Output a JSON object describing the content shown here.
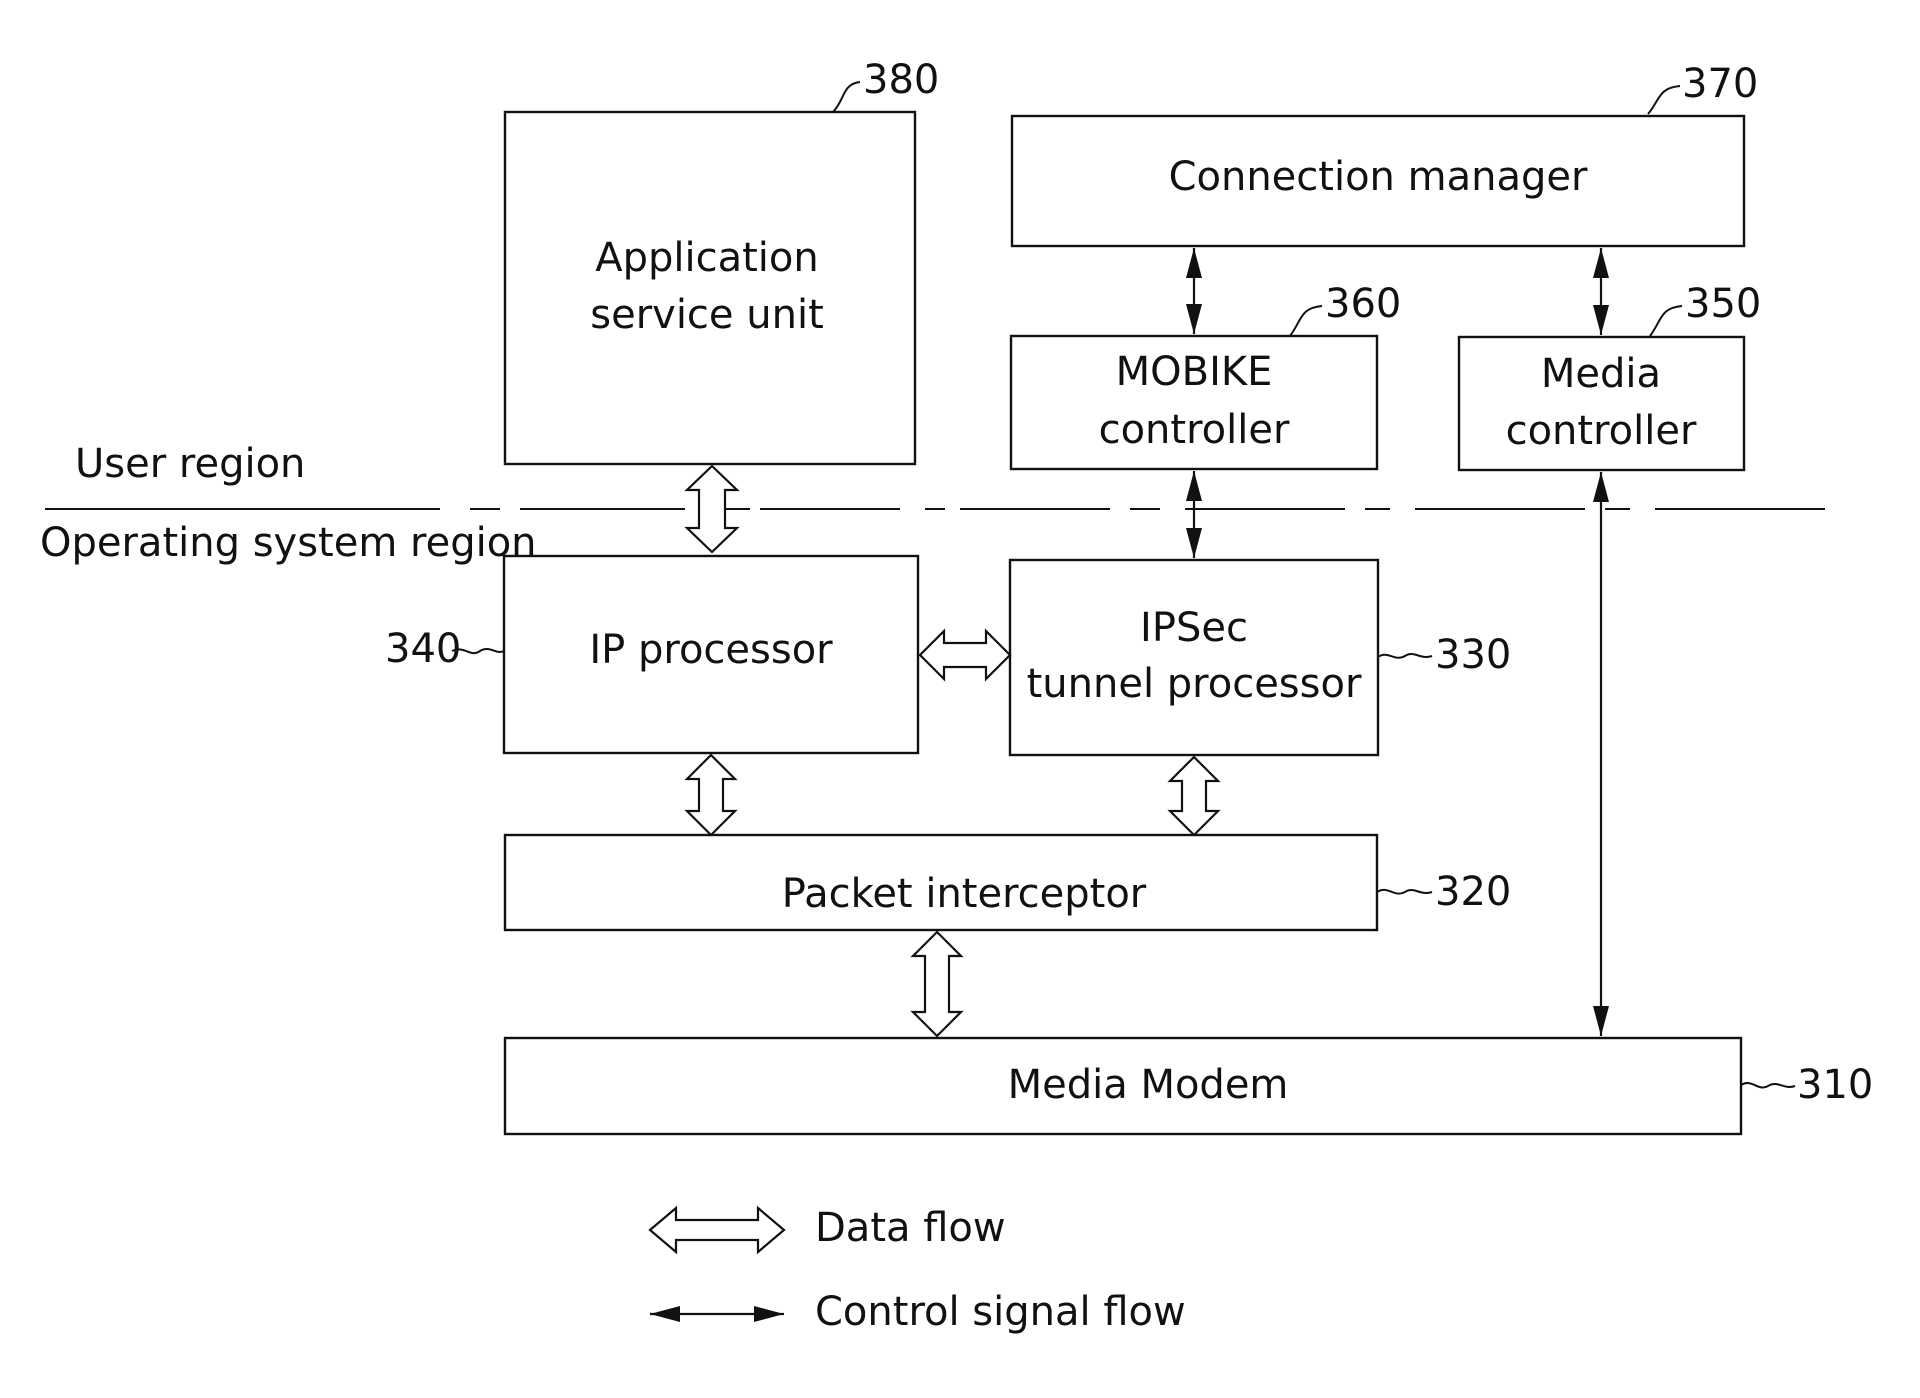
{
  "diagram": {
    "blocks": {
      "app_service": {
        "lines": [
          "Application",
          "service unit"
        ],
        "ref": "380"
      },
      "connection_manager": {
        "lines": [
          "Connection manager"
        ],
        "ref": "370"
      },
      "mobike_controller": {
        "lines": [
          "MOBIKE",
          "controller"
        ],
        "ref": "360"
      },
      "media_controller": {
        "lines": [
          "Media",
          "controller"
        ],
        "ref": "350"
      },
      "ip_processor": {
        "lines": [
          "IP processor"
        ],
        "ref": "340"
      },
      "ipsec_tunnel": {
        "lines": [
          "IPSec",
          "tunnel processor"
        ],
        "ref": "330"
      },
      "packet_interceptor": {
        "lines": [
          "Packet interceptor"
        ],
        "ref": "320"
      },
      "media_modem": {
        "lines": [
          "Media Modem"
        ],
        "ref": "310"
      }
    },
    "regions": {
      "user": "User region",
      "os": "Operating system region"
    },
    "connections": [
      {
        "from": "app_service",
        "to": "ip_processor",
        "type": "data"
      },
      {
        "from": "ip_processor",
        "to": "ipsec_tunnel",
        "type": "data"
      },
      {
        "from": "ip_processor",
        "to": "packet_interceptor",
        "type": "data"
      },
      {
        "from": "ipsec_tunnel",
        "to": "packet_interceptor",
        "type": "data"
      },
      {
        "from": "packet_interceptor",
        "to": "media_modem",
        "type": "data"
      },
      {
        "from": "connection_manager",
        "to": "mobike_controller",
        "type": "control"
      },
      {
        "from": "connection_manager",
        "to": "media_controller",
        "type": "control"
      },
      {
        "from": "mobike_controller",
        "to": "ipsec_tunnel",
        "type": "control"
      },
      {
        "from": "media_controller",
        "to": "media_modem",
        "type": "control"
      }
    ],
    "legend": {
      "data_flow": "Data flow",
      "control_flow": "Control signal flow"
    }
  }
}
